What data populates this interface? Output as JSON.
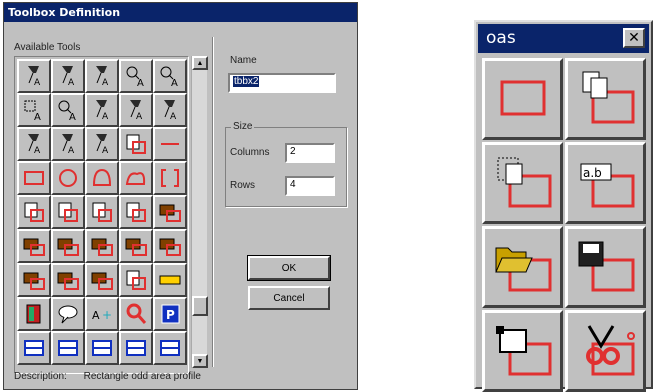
{
  "dialog": {
    "title": "Toolbox Definition",
    "available_tools_label": "Available Tools",
    "name_label": "Name",
    "name_value": "tbbx2",
    "size_label": "Size",
    "columns_label": "Columns",
    "columns_value": "2",
    "rows_label": "Rows",
    "rows_value": "4",
    "ok_label": "OK",
    "cancel_label": "Cancel",
    "description_label": "Description:",
    "description_value": "Rectangle odd area profile",
    "tool_icons": [
      "pin-pmb",
      "pin-hms",
      "pin-pmb2",
      "zoom-a",
      "zoom-a2",
      "select-a",
      "zoom-a3",
      "pin-a",
      "pin-a2",
      "pin-a3",
      "pin-a4",
      "pin-a5",
      "pin-a6",
      "doc-a",
      "line",
      "rect",
      "circle",
      "arc",
      "freeform",
      "bracket",
      "copy-doc",
      "copy-doc2",
      "edit-doc",
      "scissors-doc",
      "open-folder",
      "palette1",
      "palette2",
      "palette3",
      "palette4",
      "palette5",
      "palette6",
      "palette7",
      "palette8",
      "scissors-doc2",
      "bar",
      "book",
      "speech",
      "text-plus",
      "magnifier",
      "parking",
      "layers",
      "split-h",
      "split-v",
      "split-h2",
      "scale"
    ]
  },
  "palette": {
    "title": "oas",
    "close_label": "✕",
    "buttons": [
      "rectangle-area",
      "copy-area",
      "paste-area",
      "text-area",
      "open-folder-area",
      "save-area",
      "select-area",
      "clip-area"
    ],
    "text_button_label": "a.b"
  }
}
